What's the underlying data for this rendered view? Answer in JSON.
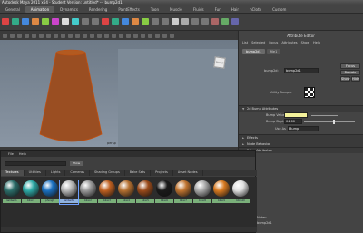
{
  "window": {
    "title": "Autodesk Maya 2011 x64 - Student Version: untitled* --- bump2d1"
  },
  "menu_tabs": [
    "General",
    "Animation",
    "Dynamics",
    "Rendering",
    "PaintEffects",
    "Toon",
    "Muscle",
    "Fluids",
    "Fur",
    "Hair",
    "nCloth",
    "Custom"
  ],
  "active_menu_tab": "Animation",
  "shelf_menus": [
    "View",
    "Shading",
    "Lighting",
    "Show",
    "Renderer",
    "Panels"
  ],
  "viewport": {
    "label": "persp"
  },
  "attribute_editor": {
    "title": "Attribute Editor",
    "menus": [
      "List",
      "Selected",
      "Focus",
      "Attributes",
      "Show",
      "Help"
    ],
    "tabs": [
      "bump2d1",
      "file1"
    ],
    "active_tab": "bump2d1",
    "node_label": "bump2d:",
    "node_value": "bump2d1",
    "focus_label": "Focus",
    "presets_label": "Presets",
    "show_label": "Show",
    "hide_label": "Hide",
    "sample_label": "Utility Sample",
    "sections": [
      {
        "name": "2d Bump Attributes",
        "open": true
      },
      {
        "name": "Effects",
        "open": false
      },
      {
        "name": "Node Behavior",
        "open": false
      },
      {
        "name": "Extra Attributes",
        "open": false
      }
    ],
    "bump_value_label": "Bump Value",
    "bump_value": "",
    "bump_depth_label": "Bump Depth",
    "bump_depth": "0.100",
    "use_as_label": "Use As",
    "use_as_value": "Bump",
    "notes_label": "Notes:",
    "notes_value": "bump2d1"
  },
  "hypershade": {
    "menu": [
      "File",
      "Help"
    ],
    "show_label": "Show",
    "tabs": [
      "Textures",
      "Utilities",
      "Lights",
      "Cameras",
      "Shading Groups",
      "Bake Sets",
      "Projects",
      "Asset Nodes"
    ],
    "active_tab": "Textures",
    "swatches": [
      {
        "label": "lambert1",
        "color": "#2c6e6a",
        "selected": false
      },
      {
        "label": "blinn1",
        "color": "#2da9a6",
        "selected": false
      },
      {
        "label": "phong1",
        "color": "#1a70c0",
        "selected": false
      },
      {
        "label": "lambert2",
        "color": "#b8b8b8",
        "selected": true
      },
      {
        "label": "blinn2",
        "color": "#9a9a9a",
        "selected": false
      },
      {
        "label": "blinn3",
        "color": "#c06020",
        "selected": false
      },
      {
        "label": "blinn4",
        "color": "#b57030",
        "selected": false
      },
      {
        "label": "blinn5",
        "color": "#9a4a1a",
        "selected": false
      },
      {
        "label": "blinn6",
        "color": "#1a1a1a",
        "selected": false
      },
      {
        "label": "blinn7",
        "color": "#c07430",
        "selected": false
      },
      {
        "label": "blinn8",
        "color": "#aaaaaa",
        "selected": false
      },
      {
        "label": "blinn9",
        "color": "#d87a20",
        "selected": false
      },
      {
        "label": "blinn10",
        "color": "#e0e0e0",
        "selected": false
      }
    ]
  },
  "colors": {
    "accent": "#5c5c5c",
    "viewport_top": "#6e7a87",
    "field_highlight": "#f3f19a"
  }
}
